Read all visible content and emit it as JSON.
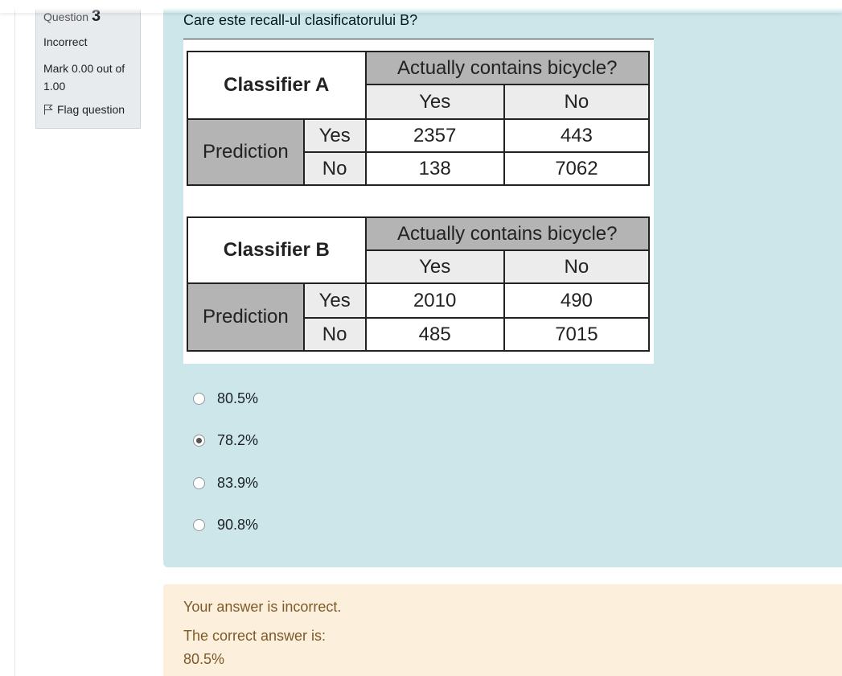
{
  "info": {
    "question_prefix": "Question",
    "question_number": "3",
    "state": "Incorrect",
    "grade": "Mark 0.00 out of 1.00",
    "flag_label": "Flag question"
  },
  "question": {
    "text": "Care este recall-ul clasificatorului B?",
    "tables": [
      {
        "title": "Classifier A",
        "header": "Actually contains bicycle?",
        "col_labels": [
          "Yes",
          "No"
        ],
        "row_group": "Prediction",
        "row_labels": [
          "Yes",
          "No"
        ],
        "values": [
          [
            "2357",
            "443"
          ],
          [
            "138",
            "7062"
          ]
        ]
      },
      {
        "title": "Classifier B",
        "header": "Actually contains bicycle?",
        "col_labels": [
          "Yes",
          "No"
        ],
        "row_group": "Prediction",
        "row_labels": [
          "Yes",
          "No"
        ],
        "values": [
          [
            "2010",
            "490"
          ],
          [
            "485",
            "7015"
          ]
        ]
      }
    ],
    "options": [
      {
        "label": "80.5%",
        "checked": false
      },
      {
        "label": "78.2%",
        "checked": true
      },
      {
        "label": "83.9%",
        "checked": false
      },
      {
        "label": "90.8%",
        "checked": false
      }
    ]
  },
  "outcome": {
    "feedback": "Your answer is incorrect.",
    "correct_label": "The correct answer is:",
    "correct_value": "80.5%"
  },
  "colors": {
    "formulation_bg": "#cce6ea",
    "outcome_bg": "#fcefdc",
    "outcome_text": "#7d5a29",
    "table_header_bg": "#b4b4b4",
    "table_sub_bg": "#ececec"
  }
}
